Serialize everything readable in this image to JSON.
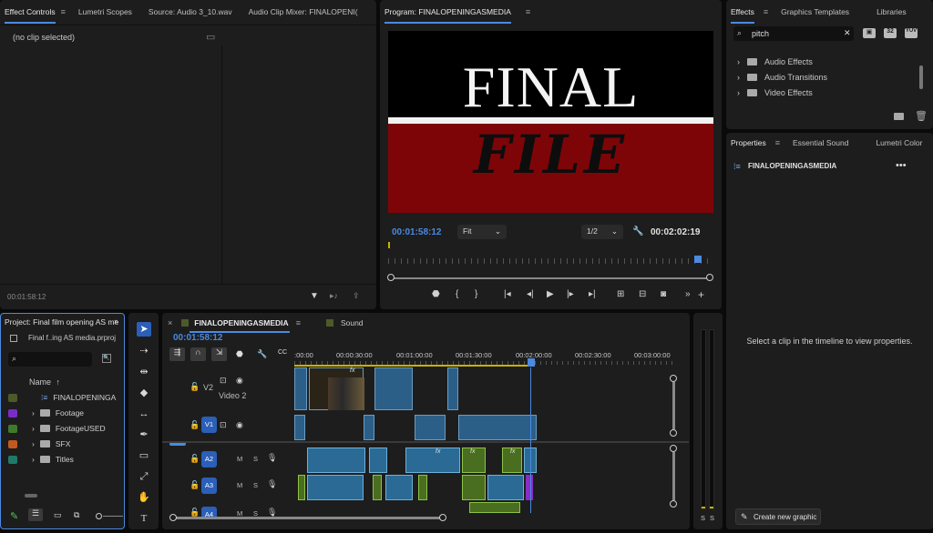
{
  "effect_controls": {
    "tabs": [
      "Effect Controls",
      "Lumetri Scopes",
      "Source: Audio 3_10.wav",
      "Audio Clip Mixer: FINALOPENI("
    ],
    "no_clip": "(no clip selected)",
    "timecode": "00:01:58:12"
  },
  "program": {
    "title": "Program: FINALOPENINGASMEDIA",
    "video_line1": "FINAL",
    "video_line2": "FILE",
    "timecode": "00:01:58:12",
    "fit": "Fit",
    "resolution": "1/2",
    "duration": "00:02:02:19"
  },
  "effects": {
    "tabs": [
      "Effects",
      "Graphics Templates",
      "Libraries"
    ],
    "search_value": "pitch",
    "badges": [
      "32",
      "YUV"
    ],
    "tree": [
      "Audio Effects",
      "Audio Transitions",
      "Video Effects"
    ]
  },
  "properties": {
    "tabs": [
      "Properties",
      "Essential Sound",
      "Lumetri Color"
    ],
    "sequence": "FINALOPENINGASMEDIA",
    "empty_msg": "Select a clip in the timeline to view properties.",
    "create_graphic": "Create new graphic"
  },
  "project": {
    "title": "Project: Final film opening AS me",
    "file": "Final f..ing AS media.prproj",
    "column_name": "Name",
    "items": [
      {
        "label": "FINALOPENINGA",
        "color": "#4c5a2a",
        "type": "sequence"
      },
      {
        "label": "Footage",
        "color": "#7a2cc7",
        "type": "folder"
      },
      {
        "label": "FootageUSED",
        "color": "#3e7a2a",
        "type": "folder"
      },
      {
        "label": "SFX",
        "color": "#c25a1f",
        "type": "folder"
      },
      {
        "label": "Titles",
        "color": "#1f7a6a",
        "type": "folder"
      }
    ]
  },
  "timeline": {
    "tabs": [
      "FINALOPENINGASMEDIA",
      "Sound"
    ],
    "timecode": "00:01:58:12",
    "ruler": [
      ":00:00",
      "00:00:30:00",
      "00:01:00:00",
      "00:01:30:00",
      "00:02:00:00",
      "00:02:30:00",
      "00:03:00:00"
    ],
    "tracks": {
      "v2": {
        "label": "V2",
        "name": "Video 2"
      },
      "v1": {
        "label": "V1"
      },
      "a2": {
        "label": "A2",
        "m": "M",
        "s": "S"
      },
      "a3": {
        "label": "A3",
        "m": "M",
        "s": "S"
      },
      "a4": {
        "label": "A4",
        "m": "M",
        "s": "S"
      }
    },
    "fx": "fx"
  },
  "meter": {
    "s1": "S",
    "s2": "S"
  }
}
